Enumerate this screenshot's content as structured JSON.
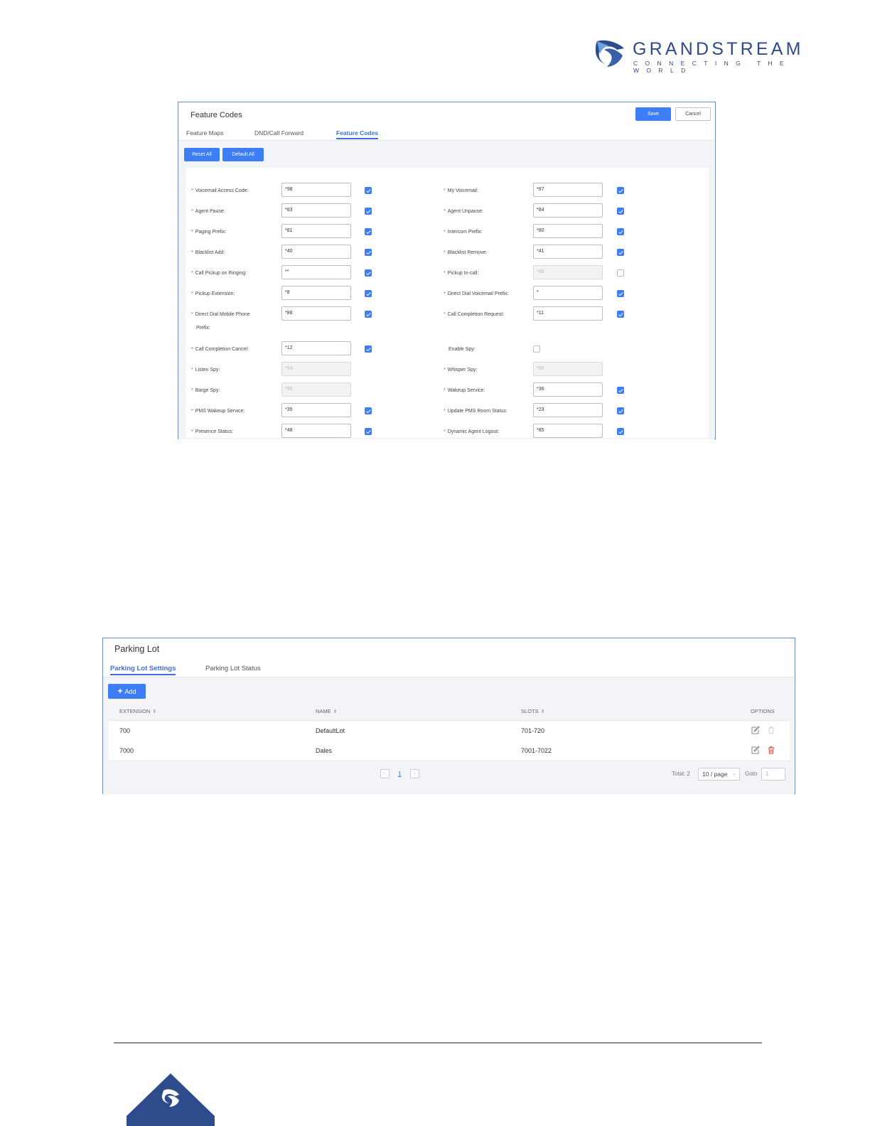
{
  "brand": {
    "name": "GRANDSTREAM",
    "tagline": "CONNECTING THE WORLD",
    "color": "#2e4b8b"
  },
  "feature_codes": {
    "title": "Feature Codes",
    "save_label": "Save",
    "cancel_label": "Cancel",
    "tabs": [
      {
        "label": "Feature Maps",
        "active": false
      },
      {
        "label": "DND/Call Forward",
        "active": false
      },
      {
        "label": "Feature Codes",
        "active": true
      }
    ],
    "reset_all_label": "Reset All",
    "default_all_label": "Default All",
    "left": [
      {
        "label": "Voicemail Access Code:",
        "required": true,
        "value": "*98",
        "enabled": true,
        "checked": true
      },
      {
        "label": "Agent Pause:",
        "required": true,
        "value": "*83",
        "enabled": true,
        "checked": true
      },
      {
        "label": "Paging Prefix:",
        "required": true,
        "value": "*81",
        "enabled": true,
        "checked": true
      },
      {
        "label": "Blacklist Add:",
        "required": true,
        "value": "*40",
        "enabled": true,
        "checked": true
      },
      {
        "label": "Call Pickup on Ringing:",
        "required": true,
        "value": "**",
        "enabled": true,
        "checked": true
      },
      {
        "label": "Pickup Extension:",
        "required": true,
        "value": "*8",
        "enabled": true,
        "checked": true
      },
      {
        "label": "Direct Dial Mobile Phone",
        "label2": "Prefix:",
        "required": true,
        "value": "*88",
        "enabled": true,
        "checked": true
      },
      {
        "label": "Call Completion Cancel:",
        "required": true,
        "value": "*12",
        "enabled": true,
        "checked": true
      },
      {
        "label": "Listen Spy:",
        "required": true,
        "value": "*54",
        "enabled": false,
        "checked": null
      },
      {
        "label": "Barge Spy:",
        "required": true,
        "value": "*56",
        "enabled": false,
        "checked": null
      },
      {
        "label": "PMS Wakeup Service:",
        "required": true,
        "value": "*35",
        "enabled": true,
        "checked": true
      },
      {
        "label": "Presence Status:",
        "required": true,
        "value": "*48",
        "enabled": true,
        "checked": true
      }
    ],
    "right": [
      {
        "label": "My Voicemail:",
        "required": true,
        "value": "*97",
        "enabled": true,
        "checked": true
      },
      {
        "label": "Agent Unpause:",
        "required": true,
        "value": "*84",
        "enabled": true,
        "checked": true
      },
      {
        "label": "Intercom Prefix:",
        "required": true,
        "value": "*80",
        "enabled": true,
        "checked": true
      },
      {
        "label": "Blacklist Remove:",
        "required": true,
        "value": "*41",
        "enabled": true,
        "checked": true
      },
      {
        "label": "Pickup In-call:",
        "required": true,
        "value": "*45",
        "enabled": false,
        "checked": false
      },
      {
        "label": "Direct Dial Voicemail Prefix:",
        "required": true,
        "value": "*",
        "enabled": true,
        "checked": true
      },
      {
        "label": "Call Completion Request:",
        "required": true,
        "value": "*11",
        "enabled": true,
        "checked": true
      },
      {
        "label": "Enable Spy:",
        "required": false,
        "value": null,
        "enabled": true,
        "checked": false
      },
      {
        "label": "Whisper Spy:",
        "required": true,
        "value": "*55",
        "enabled": false,
        "checked": null
      },
      {
        "label": "Wakeup Service:",
        "required": true,
        "value": "*36",
        "enabled": true,
        "checked": true
      },
      {
        "label": "Update PMS Room Status:",
        "required": true,
        "value": "*23",
        "enabled": true,
        "checked": true
      },
      {
        "label": "Dynamic Agent Logout:",
        "required": true,
        "value": "*85",
        "enabled": true,
        "checked": true
      }
    ]
  },
  "parking_lot": {
    "title": "Parking Lot",
    "tabs": [
      {
        "label": "Parking Lot Settings",
        "active": true
      },
      {
        "label": "Parking Lot Status",
        "active": false
      }
    ],
    "add_label": "Add",
    "columns": [
      "EXTENSION",
      "NAME",
      "SLOTS",
      "OPTIONS"
    ],
    "rows": [
      {
        "extension": "700",
        "name": "DefaultLot",
        "slots": "701-720",
        "delete_enabled": false
      },
      {
        "extension": "7000",
        "name": "Dales",
        "slots": "7001-7022",
        "delete_enabled": true
      }
    ],
    "pagination": {
      "current_page": "1",
      "total_label": "Total: 2",
      "page_size": "10 / page",
      "goto_label": "Goto",
      "goto_value": "1"
    }
  },
  "colors": {
    "accent": "#3d7ef7",
    "required": "#e0453a",
    "delete": "#e0453a"
  }
}
